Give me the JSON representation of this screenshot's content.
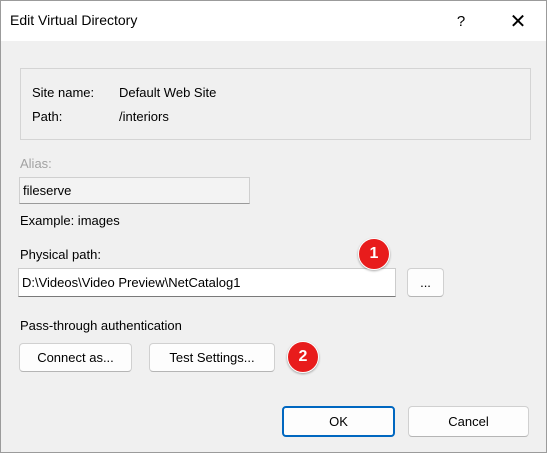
{
  "window": {
    "title": "Edit Virtual Directory",
    "help_label": "?",
    "close_label": "✕"
  },
  "info": {
    "site_name_label": "Site name:",
    "site_name_value": "Default Web Site",
    "path_label": "Path:",
    "path_value": "/interiors"
  },
  "alias": {
    "label": "Alias:",
    "value": "fileserve",
    "example": "Example: images"
  },
  "physical_path": {
    "label": "Physical path:",
    "value": "D:\\Videos\\Video Preview\\NetCatalog1",
    "browse_label": "..."
  },
  "auth": {
    "label": "Pass-through authentication",
    "connect_as_label": "Connect as...",
    "test_settings_label": "Test Settings..."
  },
  "footer": {
    "ok_label": "OK",
    "cancel_label": "Cancel"
  },
  "annotations": {
    "badge1": "1",
    "badge2": "2"
  },
  "colors": {
    "badge": "#e81c1c",
    "focus_border": "#0067c0"
  }
}
